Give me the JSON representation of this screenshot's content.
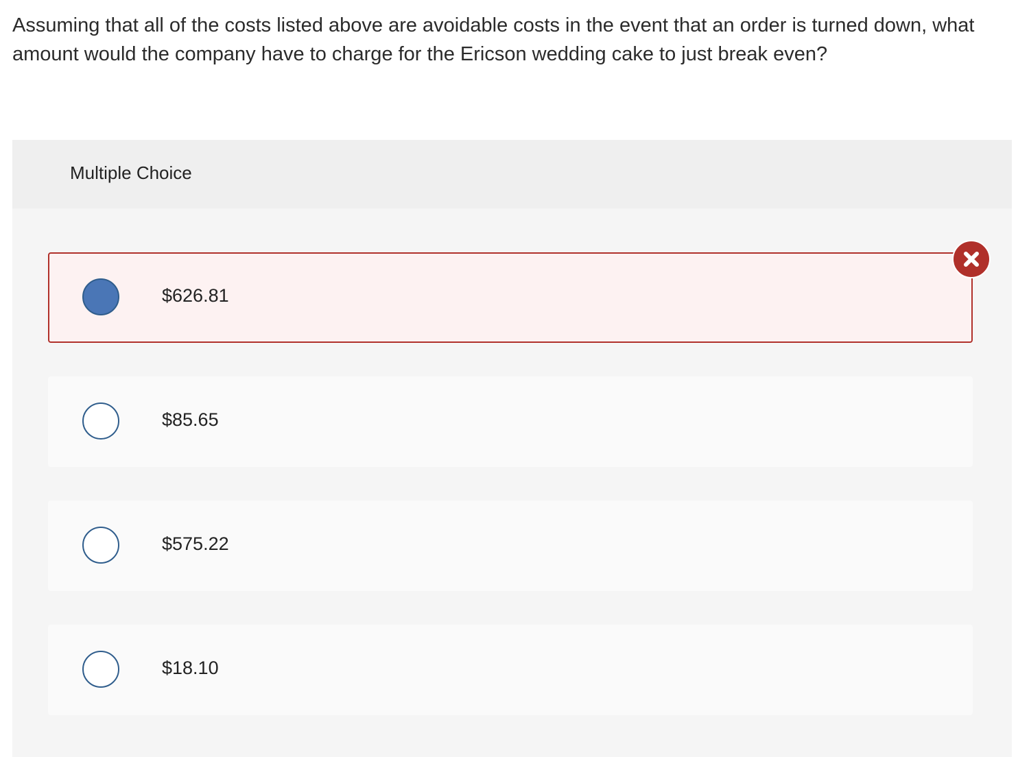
{
  "question": {
    "text": "Assuming that all of the costs listed above are avoidable costs in the event that an order is turned down, what amount would the company have to charge for the Ericson wedding cake to just break even?"
  },
  "multiple_choice": {
    "header": "Multiple Choice",
    "options": [
      {
        "label": "$626.81",
        "selected": true,
        "status": "incorrect"
      },
      {
        "label": "$85.65",
        "selected": false
      },
      {
        "label": "$575.22",
        "selected": false
      },
      {
        "label": "$18.10",
        "selected": false
      }
    ]
  },
  "icons": {
    "incorrect_badge": "close-icon",
    "radio": "radio-button"
  },
  "colors": {
    "incorrect": "#b0302a",
    "selected_radio": "#4a76b6",
    "radio_border": "#2f5d8c",
    "incorrect_background": "#fdf2f2"
  }
}
